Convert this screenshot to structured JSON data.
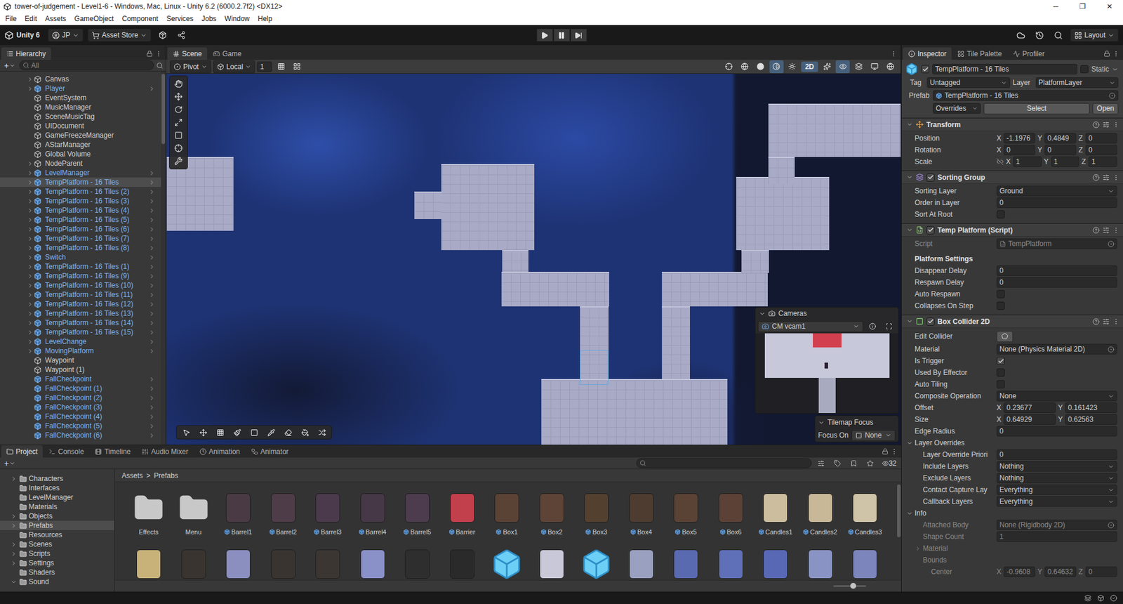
{
  "window": {
    "title": "tower-of-judgement - Level1-6 - Windows, Mac, Linux - Unity 6.2 (6000.2.7f2) <DX12>",
    "controls": [
      "─",
      "❐",
      "✕"
    ]
  },
  "menu": [
    "File",
    "Edit",
    "Assets",
    "GameObject",
    "Component",
    "Services",
    "Jobs",
    "Window",
    "Help"
  ],
  "toolbar": {
    "account": "Unity 6",
    "user": "JP",
    "store": "Asset Store",
    "layout": "Layout",
    "playing": false,
    "paused": false
  },
  "hierarchy": {
    "tab": {
      "label": "Hierarchy",
      "kind": "hierarchy",
      "selected": true
    },
    "add": "+",
    "search": "All",
    "items": [
      {
        "name": "Canvas",
        "prefab": false,
        "hasChildren": true,
        "selected": false
      },
      {
        "name": "Player",
        "prefab": true,
        "hasChildren": true,
        "selected": false
      },
      {
        "name": "EventSystem",
        "prefab": false,
        "hasChildren": false,
        "selected": false
      },
      {
        "name": "MusicManager",
        "prefab": false,
        "hasChildren": false,
        "selected": false
      },
      {
        "name": "SceneMusicTag",
        "prefab": false,
        "hasChildren": false,
        "selected": false
      },
      {
        "name": "UIDocument",
        "prefab": false,
        "hasChildren": false,
        "selected": false
      },
      {
        "name": "GameFreezeManager",
        "prefab": false,
        "hasChildren": false,
        "selected": false
      },
      {
        "name": "AStarManager",
        "prefab": false,
        "hasChildren": false,
        "selected": false
      },
      {
        "name": "Global Volume",
        "prefab": false,
        "hasChildren": false,
        "selected": false
      },
      {
        "name": "NodeParent",
        "prefab": false,
        "hasChildren": true,
        "selected": false
      },
      {
        "name": "LevelManager",
        "prefab": true,
        "hasChildren": true,
        "selected": false
      },
      {
        "name": "TempPlatform - 16 Tiles",
        "prefab": true,
        "hasChildren": true,
        "selected": true
      },
      {
        "name": "TempPlatform - 16 Tiles (2)",
        "prefab": true,
        "hasChildren": true,
        "selected": false
      },
      {
        "name": "TempPlatform - 16 Tiles (3)",
        "prefab": true,
        "hasChildren": true,
        "selected": false
      },
      {
        "name": "TempPlatform - 16 Tiles (4)",
        "prefab": true,
        "hasChildren": true,
        "selected": false
      },
      {
        "name": "TempPlatform - 16 Tiles (5)",
        "prefab": true,
        "hasChildren": true,
        "selected": false
      },
      {
        "name": "TempPlatform - 16 Tiles (6)",
        "prefab": true,
        "hasChildren": true,
        "selected": false
      },
      {
        "name": "TempPlatform - 16 Tiles (7)",
        "prefab": true,
        "hasChildren": true,
        "selected": false
      },
      {
        "name": "TempPlatform - 16 Tiles (8)",
        "prefab": true,
        "hasChildren": true,
        "selected": false
      },
      {
        "name": "Switch",
        "prefab": true,
        "hasChildren": true,
        "selected": false
      },
      {
        "name": "TempPlatform - 16 Tiles (1)",
        "prefab": true,
        "hasChildren": true,
        "selected": false
      },
      {
        "name": "TempPlatform - 16 Tiles (9)",
        "prefab": true,
        "hasChildren": true,
        "selected": false
      },
      {
        "name": "TempPlatform - 16 Tiles (10)",
        "prefab": true,
        "hasChildren": true,
        "selected": false
      },
      {
        "name": "TempPlatform - 16 Tiles (11)",
        "prefab": true,
        "hasChildren": true,
        "selected": false
      },
      {
        "name": "TempPlatform - 16 Tiles (12)",
        "prefab": true,
        "hasChildren": true,
        "selected": false
      },
      {
        "name": "TempPlatform - 16 Tiles (13)",
        "prefab": true,
        "hasChildren": true,
        "selected": false
      },
      {
        "name": "TempPlatform - 16 Tiles (14)",
        "prefab": true,
        "hasChildren": true,
        "selected": false
      },
      {
        "name": "TempPlatform - 16 Tiles (15)",
        "prefab": true,
        "hasChildren": true,
        "selected": false
      },
      {
        "name": "LevelChange",
        "prefab": true,
        "hasChildren": true,
        "selected": false
      },
      {
        "name": "MovingPlatform",
        "prefab": true,
        "hasChildren": true,
        "selected": false
      },
      {
        "name": "Waypoint",
        "prefab": false,
        "hasChildren": false,
        "selected": false
      },
      {
        "name": "Waypoint (1)",
        "prefab": false,
        "hasChildren": false,
        "selected": false
      },
      {
        "name": "FallCheckpoint",
        "prefab": true,
        "hasChildren": false,
        "selected": false
      },
      {
        "name": "FallCheckpoint (1)",
        "prefab": true,
        "hasChildren": false,
        "selected": false
      },
      {
        "name": "FallCheckpoint (2)",
        "prefab": true,
        "hasChildren": false,
        "selected": false
      },
      {
        "name": "FallCheckpoint (3)",
        "prefab": true,
        "hasChildren": false,
        "selected": false
      },
      {
        "name": "FallCheckpoint (4)",
        "prefab": true,
        "hasChildren": false,
        "selected": false
      },
      {
        "name": "FallCheckpoint (5)",
        "prefab": true,
        "hasChildren": false,
        "selected": false
      },
      {
        "name": "FallCheckpoint (6)",
        "prefab": true,
        "hasChildren": false,
        "selected": false
      }
    ]
  },
  "scene": {
    "tabs": [
      {
        "label": "Scene",
        "kind": "scene",
        "selected": true
      },
      {
        "label": "Game",
        "kind": "game",
        "selected": false
      }
    ],
    "pivot": "Pivot",
    "space": "Local",
    "gridSize": "1",
    "mode2d": {
      "label": "2D",
      "on": true
    },
    "cameras": {
      "title": "Cameras",
      "camera": "CM vcam1"
    },
    "tilemapFocus": {
      "title": "Tilemap Focus",
      "label": "Focus On",
      "value": "None"
    }
  },
  "inspector": {
    "tabs": [
      {
        "label": "Inspector",
        "kind": "inspector",
        "selected": true
      },
      {
        "label": "Tile Palette",
        "kind": "tile-palette",
        "selected": false
      },
      {
        "label": "Profiler",
        "kind": "profiler",
        "selected": false
      }
    ],
    "object": {
      "active": true,
      "name": "TempPlatform - 16 Tiles",
      "static": false,
      "staticLabel": "Static",
      "tagLabel": "Tag",
      "tag": "Untagged",
      "layerLabel": "Layer",
      "layer": "PlatformLayer",
      "prefabLabel": "Prefab",
      "prefab": "TempPlatform - 16 Tiles",
      "overrides": "Overrides",
      "select": "Select",
      "open": "Open"
    },
    "components": [
      {
        "title": "Transform",
        "kind": "transform",
        "expanded": true,
        "rows": [
          {
            "kind": "vector",
            "label": "Position",
            "axes": [
              {
                "axis": "X",
                "value": "-1.1976"
              },
              {
                "axis": "Y",
                "value": "0.4849"
              },
              {
                "axis": "Z",
                "value": "0"
              }
            ]
          },
          {
            "kind": "vector",
            "label": "Rotation",
            "axes": [
              {
                "axis": "X",
                "value": "0"
              },
              {
                "axis": "Y",
                "value": "0"
              },
              {
                "axis": "Z",
                "value": "0"
              }
            ]
          },
          {
            "kind": "vector",
            "label": "Scale",
            "constrainProportions": false,
            "axes": [
              {
                "axis": "X",
                "value": "1"
              },
              {
                "axis": "Y",
                "value": "1"
              },
              {
                "axis": "Z",
                "value": "1"
              }
            ]
          }
        ]
      },
      {
        "title": "Sorting Group",
        "kind": "sorting-group",
        "enabled": true,
        "expanded": true,
        "rows": [
          {
            "kind": "dropdown",
            "label": "Sorting Layer",
            "value": "Ground"
          },
          {
            "kind": "number",
            "label": "Order in Layer",
            "value": "0"
          },
          {
            "kind": "checkbox",
            "label": "Sort At Root",
            "checked": false
          }
        ]
      },
      {
        "title": "Temp Platform (Script)",
        "kind": "script",
        "enabled": true,
        "expanded": true,
        "rows": [
          {
            "kind": "object",
            "label": "Script",
            "value": "TempPlatform",
            "disabled": true
          },
          {
            "kind": "header",
            "label": "Platform Settings"
          },
          {
            "kind": "number",
            "label": "Disappear Delay",
            "value": "0"
          },
          {
            "kind": "number",
            "label": "Respawn Delay",
            "value": "0"
          },
          {
            "kind": "checkbox",
            "label": "Auto Respawn",
            "checked": false
          },
          {
            "kind": "checkbox",
            "label": "Collapses On Step",
            "checked": false
          }
        ]
      },
      {
        "title": "Box Collider 2D",
        "kind": "collider",
        "enabled": true,
        "expanded": true,
        "rows": [
          {
            "kind": "button",
            "label": "Edit Collider"
          },
          {
            "kind": "object",
            "label": "Material",
            "value": "None (Physics Material 2D)"
          },
          {
            "kind": "checkbox",
            "label": "Is Trigger",
            "checked": true
          },
          {
            "kind": "checkbox",
            "label": "Used By Effector",
            "checked": false
          },
          {
            "kind": "checkbox",
            "label": "Auto Tiling",
            "checked": false
          },
          {
            "kind": "dropdown",
            "label": "Composite Operation",
            "value": "None"
          },
          {
            "kind": "vector",
            "label": "Offset",
            "axes": [
              {
                "axis": "X",
                "value": "0.23677"
              },
              {
                "axis": "Y",
                "value": "0.161423"
              }
            ]
          },
          {
            "kind": "vector",
            "label": "Size",
            "axes": [
              {
                "axis": "X",
                "value": "0.64929"
              },
              {
                "axis": "Y",
                "value": "0.62563"
              }
            ]
          },
          {
            "kind": "number",
            "label": "Edge Radius",
            "value": "0"
          },
          {
            "kind": "foldout",
            "label": "Layer Overrides",
            "expanded": true
          },
          {
            "kind": "number",
            "label": "Layer Override Priori",
            "value": "0",
            "indent": 1
          },
          {
            "kind": "dropdown",
            "label": "Include Layers",
            "value": "Nothing",
            "indent": 1
          },
          {
            "kind": "dropdown",
            "label": "Exclude Layers",
            "value": "Nothing",
            "indent": 1
          },
          {
            "kind": "dropdown",
            "label": "Contact Capture Lay",
            "value": "Everything",
            "indent": 1
          },
          {
            "kind": "dropdown",
            "label": "Callback Layers",
            "value": "Everything",
            "indent": 1
          },
          {
            "kind": "foldout",
            "label": "Info",
            "expanded": true
          },
          {
            "kind": "object",
            "label": "Attached Body",
            "value": "None (Rigidbody 2D)",
            "indent": 1,
            "disabled": true
          },
          {
            "kind": "number",
            "label": "Shape Count",
            "value": "1",
            "indent": 1,
            "disabled": true
          },
          {
            "kind": "foldout",
            "label": "Material",
            "expanded": false,
            "indent": 1,
            "disabled": true
          },
          {
            "kind": "label",
            "label": "Bounds",
            "indent": 1,
            "disabled": true
          },
          {
            "kind": "vector",
            "label": "Center",
            "indent": 2,
            "disabled": true,
            "axes": [
              {
                "axis": "X",
                "value": "-0.9608"
              },
              {
                "axis": "Y",
                "value": "0.64632"
              },
              {
                "axis": "Z",
                "value": "0"
              }
            ]
          }
        ]
      }
    ]
  },
  "project": {
    "tabs": [
      {
        "label": "Project",
        "kind": "project",
        "selected": true
      },
      {
        "label": "Console",
        "kind": "console",
        "selected": false
      },
      {
        "label": "Timeline",
        "kind": "timeline",
        "selected": false
      },
      {
        "label": "Audio Mixer",
        "kind": "audio-mixer",
        "selected": false
      },
      {
        "label": "Animation",
        "kind": "animation",
        "selected": false
      },
      {
        "label": "Animator",
        "kind": "animator",
        "selected": false
      }
    ],
    "add": "+",
    "count": "32",
    "zoom": {
      "level": 0.6
    },
    "breadcrumb": {
      "items": [
        "Assets",
        "Prefabs"
      ],
      "separator": ">"
    },
    "tree": [
      {
        "name": "Characters",
        "hasChildren": true,
        "expanded": false,
        "selected": false
      },
      {
        "name": "Interfaces",
        "hasChildren": false,
        "expanded": false,
        "selected": false
      },
      {
        "name": "LevelManager",
        "hasChildren": false,
        "expanded": false,
        "selected": false
      },
      {
        "name": "Materials",
        "hasChildren": false,
        "expanded": false,
        "selected": false
      },
      {
        "name": "Objects",
        "hasChildren": true,
        "expanded": false,
        "selected": false
      },
      {
        "name": "Prefabs",
        "hasChildren": true,
        "expanded": false,
        "selected": true
      },
      {
        "name": "Resources",
        "hasChildren": false,
        "expanded": false,
        "selected": false
      },
      {
        "name": "Scenes",
        "hasChildren": true,
        "expanded": false,
        "selected": false
      },
      {
        "name": "Scripts",
        "hasChildren": true,
        "expanded": false,
        "selected": false
      },
      {
        "name": "Settings",
        "hasChildren": true,
        "expanded": false,
        "selected": false
      },
      {
        "name": "Shaders",
        "hasChildren": false,
        "expanded": false,
        "selected": false
      },
      {
        "name": "Sound",
        "hasChildren": true,
        "expanded": true,
        "selected": false
      }
    ],
    "assets": [
      {
        "name": "Effects",
        "kind": "folder"
      },
      {
        "name": "Menu",
        "kind": "folder"
      },
      {
        "name": "Barrel1",
        "kind": "prefab",
        "color": "#4a3a44"
      },
      {
        "name": "Barrel2",
        "kind": "prefab",
        "color": "#4e3c48"
      },
      {
        "name": "Barrel3",
        "kind": "prefab",
        "color": "#4a3a4c"
      },
      {
        "name": "Barrel4",
        "kind": "prefab",
        "color": "#463846"
      },
      {
        "name": "Barrel5",
        "kind": "prefab",
        "color": "#4c3c4e"
      },
      {
        "name": "Barrier",
        "kind": "prefab",
        "color": "#c2404c"
      },
      {
        "name": "Box1",
        "kind": "prefab",
        "color": "#5a4234"
      },
      {
        "name": "Box2",
        "kind": "prefab",
        "color": "#5e4436"
      },
      {
        "name": "Box3",
        "kind": "prefab",
        "color": "#54402f"
      },
      {
        "name": "Box4",
        "kind": "prefab",
        "color": "#4e3c30"
      },
      {
        "name": "Box5",
        "kind": "prefab",
        "color": "#5a4234"
      },
      {
        "name": "Box6",
        "kind": "prefab",
        "color": "#5c4236"
      },
      {
        "name": "Candles1",
        "kind": "prefab",
        "color": "#cbbd9e"
      },
      {
        "name": "Candles2",
        "kind": "prefab",
        "color": "#c8b898"
      },
      {
        "name": "Candles3",
        "kind": "prefab",
        "color": "#d0c4a8"
      }
    ],
    "moreAssets": [
      {
        "kind": "picture",
        "color": "#c8b27a"
      },
      {
        "kind": "picture",
        "color": "#3a3430"
      },
      {
        "kind": "picture",
        "color": "#8a8fc0"
      },
      {
        "kind": "picture",
        "color": "#3a3430"
      },
      {
        "kind": "picture",
        "color": "#3c3632"
      },
      {
        "kind": "picture",
        "color": "#8a90c8"
      },
      {
        "kind": "picture",
        "color": "#2e2e2e"
      },
      {
        "kind": "picture",
        "color": "#2a2a2a"
      },
      {
        "kind": "cube"
      },
      {
        "kind": "picture",
        "color": "#c8c8d8"
      },
      {
        "kind": "cube"
      },
      {
        "kind": "picture",
        "color": "#9aa0c0"
      },
      {
        "kind": "picture",
        "color": "#5a6ab0"
      },
      {
        "kind": "picture",
        "color": "#6070b8"
      },
      {
        "kind": "picture",
        "color": "#5868b4"
      },
      {
        "kind": "picture",
        "color": "#8a94c4"
      },
      {
        "kind": "picture",
        "color": "#7c86bc"
      }
    ]
  }
}
